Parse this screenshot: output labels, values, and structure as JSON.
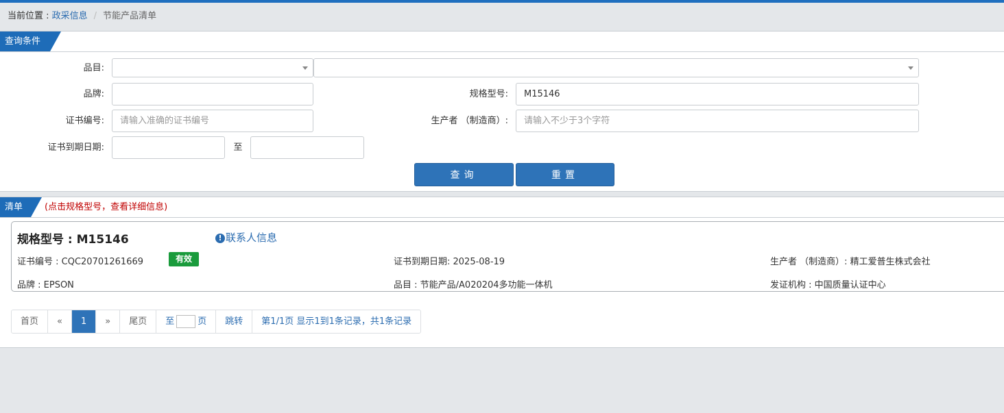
{
  "breadcrumb": {
    "prefix": "当前位置 : ",
    "link": "政采信息",
    "separator": "/",
    "current": "节能产品清单"
  },
  "query_panel": {
    "title": "查询条件",
    "fields": {
      "category_label": "品目:",
      "category_primary": "",
      "category_secondary": "",
      "brand_label": "品牌:",
      "brand_value": "",
      "model_label": "规格型号:",
      "model_value": "M15146",
      "cert_no_label": "证书编号:",
      "cert_no_placeholder": "请输入准确的证书编号",
      "producer_label": "生产者 （制造商）:",
      "producer_placeholder": "请输入不少于3个字符",
      "expiry_label": "证书到期日期:",
      "expiry_from": "",
      "expiry_to_sep": "至",
      "expiry_to": ""
    },
    "buttons": {
      "search": "查询",
      "reset": "重置"
    }
  },
  "list_panel": {
    "title": "清单",
    "note": "(点击规格型号，查看详细信息)",
    "record": {
      "model_title": "规格型号 : M15146",
      "contact_icon": "info-circle-icon",
      "contact_label": "联系人信息",
      "cert_no": "证书编号 : CQC20701261669",
      "status": "有效",
      "expiry": "证书到期日期: 2025-08-19",
      "producer": "生产者 （制造商）: 精工爱普生株式会社",
      "brand": "品牌 : EPSON",
      "category": "品目 : 节能产品/A020204多功能一体机",
      "issuer": "发证机构 : 中国质量认证中心"
    },
    "pager": {
      "first": "首页",
      "prev": "«",
      "page": "1",
      "next": "»",
      "last": "尾页",
      "goto_prefix": "至",
      "goto_suffix": "页",
      "jump": "跳转",
      "info": "第1/1页  显示1到1条记录，共1条记录"
    }
  },
  "colors": {
    "accent": "#1e6cb8",
    "button": "#2e73b8",
    "valid_badge": "#1a9b3c",
    "note_red": "#c00000",
    "background": "#e4e7ea"
  }
}
